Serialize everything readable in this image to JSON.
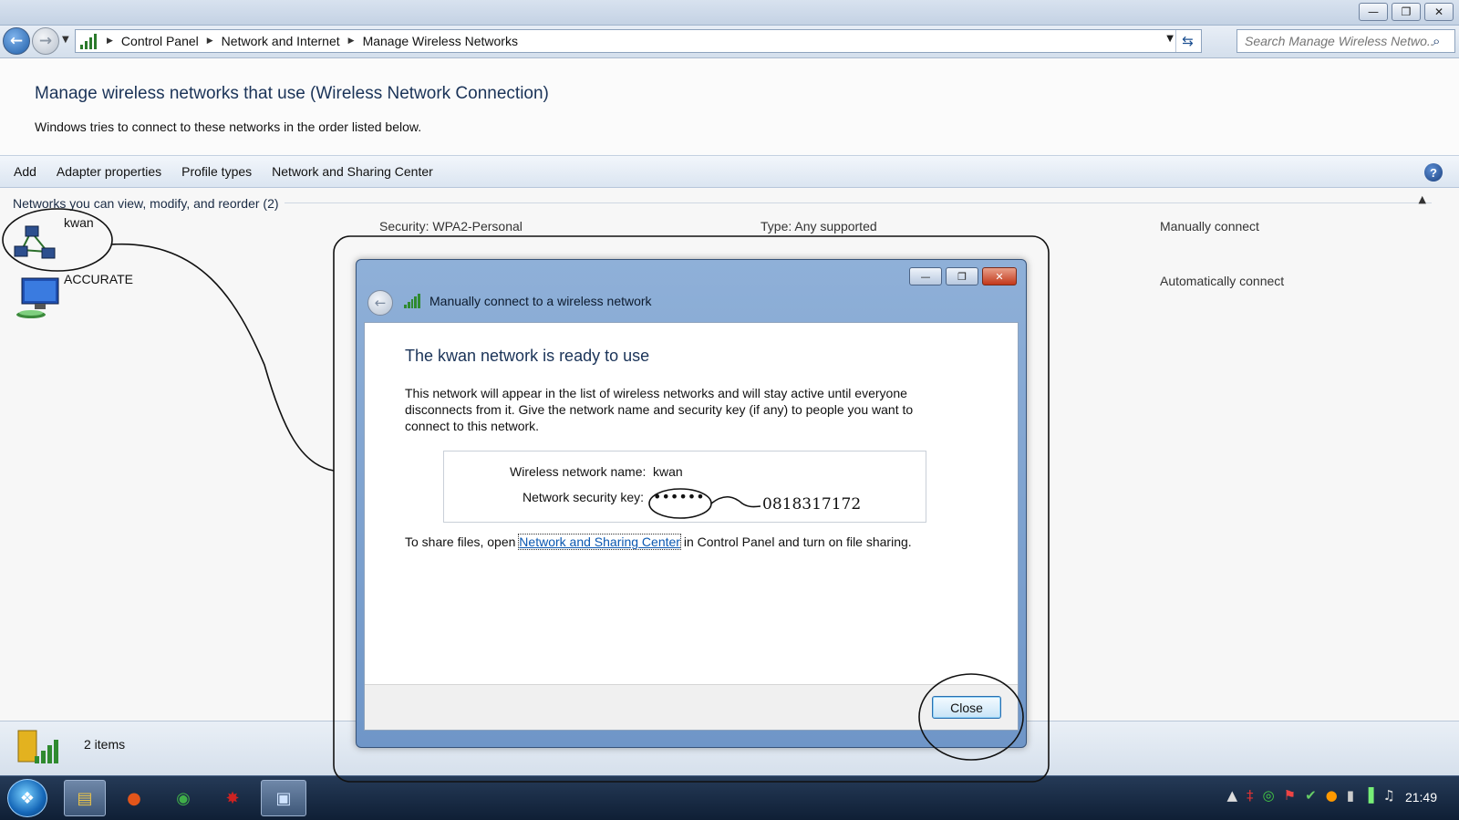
{
  "window": {
    "minimize_glyph": "—",
    "restore_glyph": "❐",
    "close_glyph": "✕"
  },
  "address": {
    "crumbs": [
      "Control Panel",
      "Network and Internet",
      "Manage Wireless Networks"
    ],
    "search_placeholder": "Search Manage Wireless Netwo..."
  },
  "header": {
    "title": "Manage wireless networks that use (Wireless Network Connection)",
    "subtitle": "Windows tries to connect to these networks in the order listed below."
  },
  "toolbar": {
    "items": [
      "Add",
      "Adapter properties",
      "Profile types",
      "Network and Sharing Center"
    ],
    "help": "?"
  },
  "networks": {
    "group_label": "Networks you can view, modify, and reorder (2)",
    "items": [
      {
        "name": "kwan",
        "security": "Security: WPA2-Personal",
        "type": "Type: Any supported",
        "mode": "Manually connect"
      },
      {
        "name": "ACCURATE",
        "mode": "Automatically connect"
      }
    ]
  },
  "status": {
    "items_count": "2 items"
  },
  "dialog": {
    "title": "Manually connect to a wireless network",
    "heading": "The kwan network is ready to use",
    "paragraph": "This network will appear in the list of wireless networks and will stay active until everyone disconnects from it. Give the network name and security key (if any) to people you want to connect to this network.",
    "name_label": "Wireless network name:",
    "name_value": "kwan",
    "key_label": "Network security key:",
    "key_value": "••••••",
    "share_before": "To share files, open ",
    "share_link": "Network and Sharing Center",
    "share_after": " in Control Panel and turn on file sharing.",
    "close_label": "Close"
  },
  "annotation": {
    "handwritten_key": "0818317172"
  },
  "taskbar": {
    "clock": "21:49"
  },
  "colors": {
    "accent": "#1a3358",
    "link": "#0b58b1",
    "taskbar": "#1a2d47"
  }
}
